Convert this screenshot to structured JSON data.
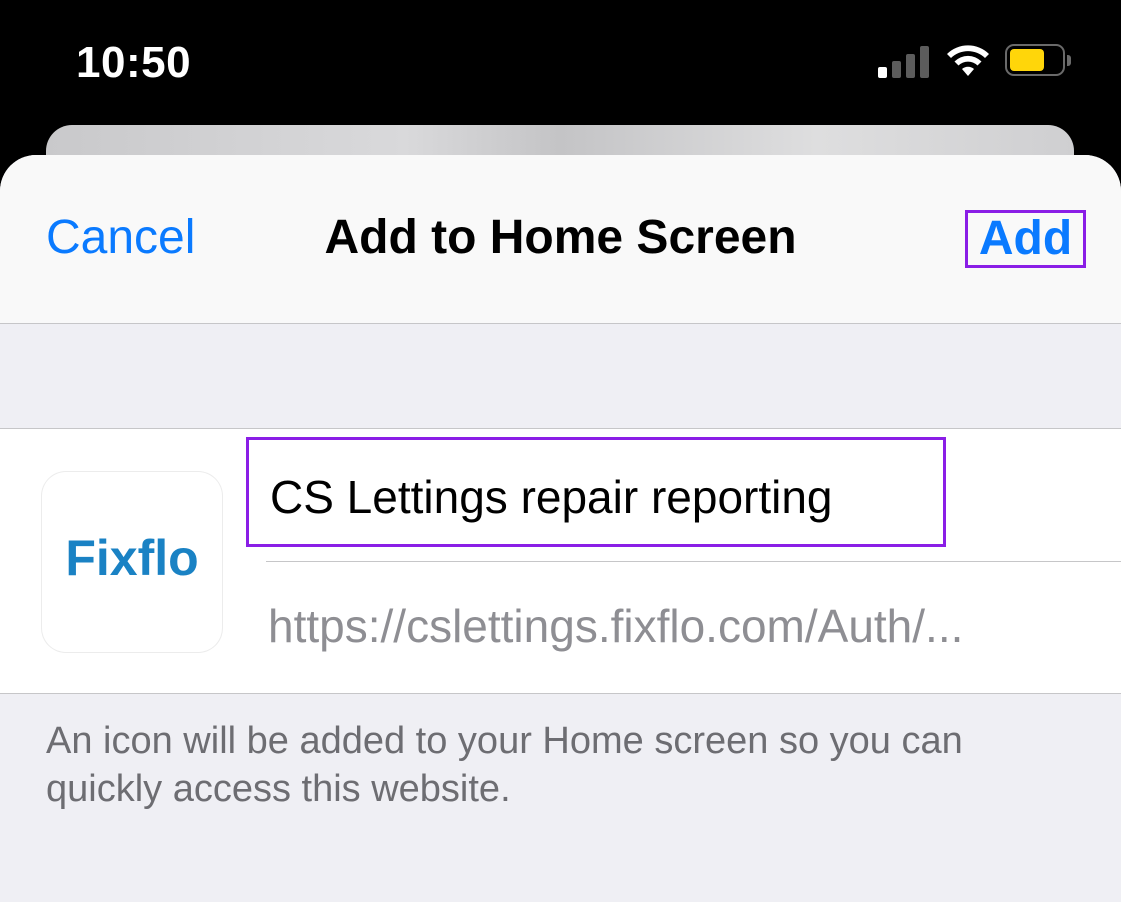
{
  "status_bar": {
    "time": "10:50",
    "signal_icon": "cellular-signal-icon",
    "wifi_icon": "wifi-icon",
    "battery_icon": "battery-icon",
    "battery_color": "#ffd60a"
  },
  "sheet": {
    "cancel_label": "Cancel",
    "title": "Add to Home Screen",
    "add_label": "Add",
    "accent_color": "#0a7aff"
  },
  "form": {
    "app_icon_label": "Fixflo",
    "name_value": "CS Lettings repair reporting",
    "url_value": "https://cslettings.fixflo.com/Auth/..."
  },
  "footer": {
    "note": "An icon will be added to your Home screen so you can quickly access this website."
  }
}
